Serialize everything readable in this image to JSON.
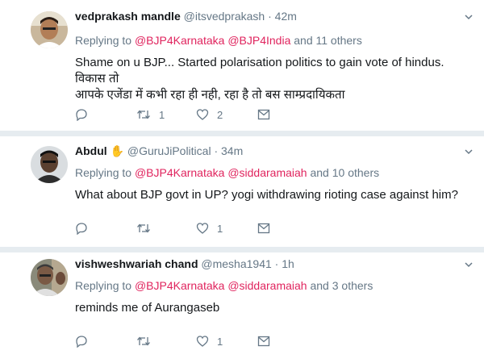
{
  "tweets": [
    {
      "name": "vedprakash mandle",
      "handle": "@itsvedprakash",
      "time": "42m",
      "replying_prefix": "Replying to",
      "mentions": [
        "@BJP4Karnataka",
        "@BJP4India"
      ],
      "others": "and 11 others",
      "text_line1": "Shame on u BJP... Started polarisation politics to gain vote of hindus. विकास तो",
      "text_line2": "आपके एजेंडा में कभी रहा ही नही, रहा है तो बस साम्प्रदायिकता",
      "retweets": "1",
      "likes": "2",
      "replies": ""
    },
    {
      "name": "Abdul",
      "badge": "✋",
      "handle": "@GuruJiPolitical",
      "time": "34m",
      "replying_prefix": "Replying to",
      "mentions": [
        "@BJP4Karnataka",
        "@siddaramaiah"
      ],
      "others": "and 10 others",
      "text_line1": "What about BJP govt in UP? yogi withdrawing rioting case against him?",
      "text_line2": "",
      "retweets": "",
      "likes": "1",
      "replies": ""
    },
    {
      "name": "vishweshwariah chand",
      "handle": "@mesha1941",
      "time": "1h",
      "replying_prefix": "Replying to",
      "mentions": [
        "@BJP4Karnataka",
        "@siddaramaiah"
      ],
      "others": "and 3 others",
      "text_line1": "reminds me of Aurangaseb",
      "text_line2": "",
      "retweets": "",
      "likes": "1",
      "replies": ""
    }
  ],
  "separator": "·",
  "colors": {
    "mention": "#e0245e",
    "secondary": "#657786",
    "divider": "#e6ecf0"
  },
  "icons": [
    "reply-icon",
    "retweet-icon",
    "like-icon",
    "message-icon",
    "chevron-down-icon"
  ]
}
